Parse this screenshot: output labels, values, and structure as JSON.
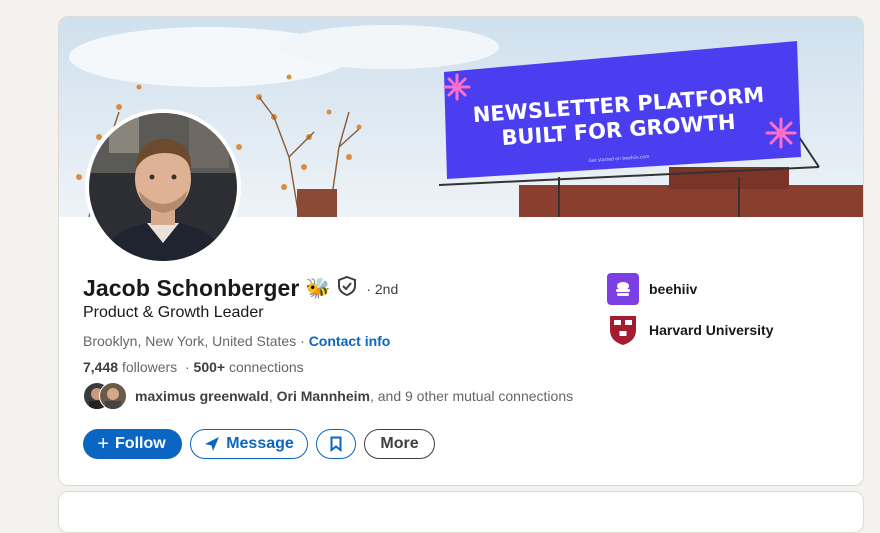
{
  "banner": {
    "headline_line1": "NEWSLETTER PLATFORM",
    "headline_line2": "BUILT FOR GROWTH",
    "fine_print": "Get started on beehiiv.com",
    "billboard_color": "#4a3ef0"
  },
  "profile": {
    "name": "Jacob Schonberger",
    "emoji": "🐝",
    "degree": "· 2nd",
    "headline": "Product & Growth Leader",
    "location": "Brooklyn, New York, United States",
    "separator": " · ",
    "contact_label": "Contact info",
    "followers_count": "7,448",
    "followers_label": "followers",
    "connections_count": "500+",
    "connections_label": "connections",
    "mutual_name1": "maximus greenwald",
    "mutual_name2": "Ori Mannheim",
    "mutual_rest": ", and 9 other mutual connections"
  },
  "actions": {
    "follow_label": "Follow",
    "message_label": "Message",
    "more_label": "More"
  },
  "orgs": [
    {
      "name": "beehiiv",
      "color": "#7b3fe4"
    },
    {
      "name": "Harvard University",
      "color": "#a51c30"
    }
  ],
  "colors": {
    "accent": "#0a66c2",
    "page_bg": "#f4f2ee"
  }
}
